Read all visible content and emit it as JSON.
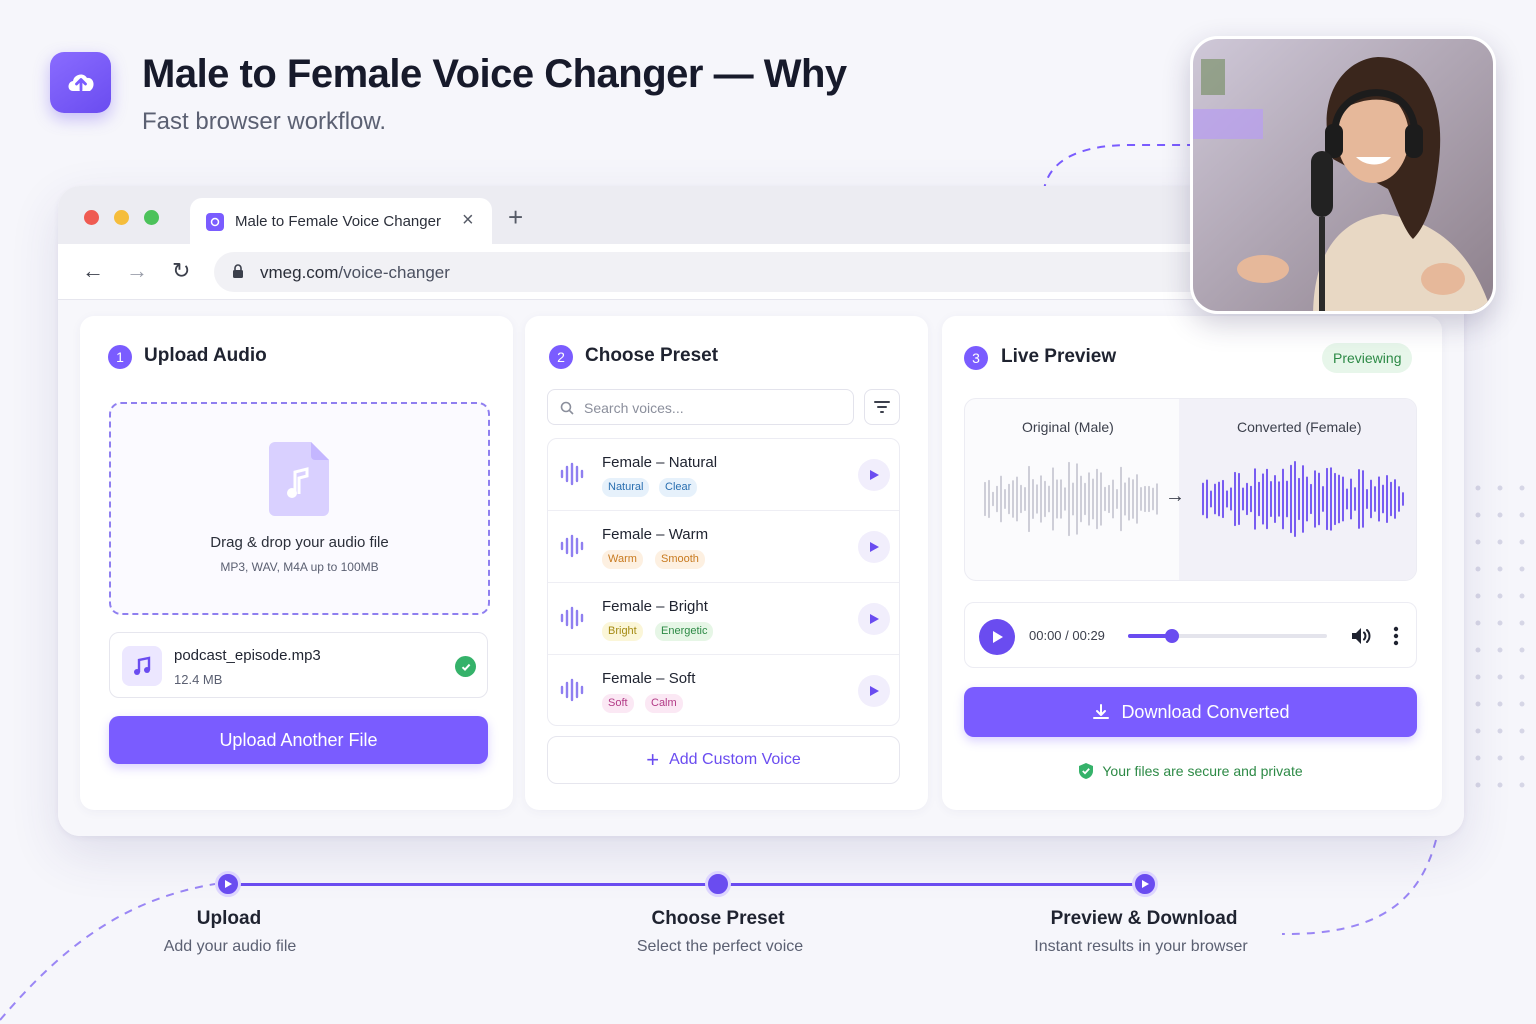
{
  "header": {
    "title": "Male to Female Voice Changer — Why",
    "subtitle": "Fast browser workflow.",
    "logo_icon": "upload-cloud-icon"
  },
  "browser": {
    "tab_title": "Male to Female Voice Changer",
    "url_domain": "vmeg.com",
    "url_path": "/voice-changer"
  },
  "upload": {
    "step": "1",
    "title": "Upload Audio",
    "drop_title": "Drag & drop your audio file",
    "drop_sub": "MP3, WAV, M4A up to 100MB",
    "file_name": "podcast_episode.mp3",
    "file_size": "12.4 MB",
    "button": "Upload Another File"
  },
  "preset": {
    "step": "2",
    "title": "Choose Preset",
    "search_placeholder": "Search voices...",
    "items": [
      {
        "name": "Female – Natural",
        "tags": [
          "Natural",
          "Clear"
        ]
      },
      {
        "name": "Female – Warm",
        "tags": [
          "Warm",
          "Smooth"
        ]
      },
      {
        "name": "Female – Bright",
        "tags": [
          "Bright",
          "Energetic"
        ]
      },
      {
        "name": "Female – Soft",
        "tags": [
          "Soft",
          "Calm"
        ]
      }
    ],
    "add_button": "Add Custom Voice"
  },
  "preview": {
    "step": "3",
    "title": "Live Preview",
    "badge": "Previewing",
    "original_label": "Original (Male)",
    "converted_label": "Converted (Female)",
    "time": "00:00 / 00:29",
    "progress": 0.22,
    "download_button": "Download Converted",
    "secure_note": "Your files are secure and private"
  },
  "steps": [
    {
      "title": "Upload",
      "sub": "Add your audio file"
    },
    {
      "title": "Choose Preset",
      "sub": "Select the perfect voice"
    },
    {
      "title": "Preview & Download",
      "sub": "Instant results in your browser"
    }
  ],
  "colors": {
    "accent": "#6a4cf0",
    "accent_light": "#7a5cff",
    "success": "#35b26a",
    "background": "#f6f6fb"
  }
}
